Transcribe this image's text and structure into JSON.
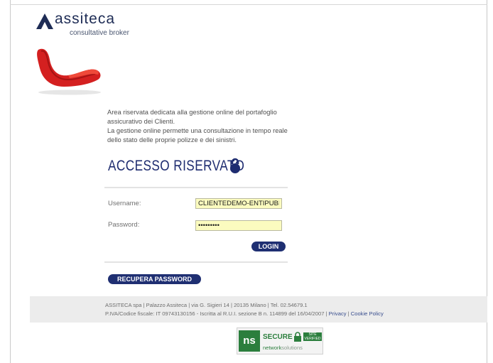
{
  "brand": {
    "name": "assiteca",
    "tagline": "consultative broker"
  },
  "intro": [
    "Area riservata dedicata alla gestione online del portafoglio",
    "assicurativo dei Clienti.",
    "La gestione online permette una consultazione in tempo reale",
    "dello stato delle proprie polizze e dei sinistri."
  ],
  "login": {
    "title": "ACCESSO RISERVATO",
    "username_label": "Username:",
    "username_value": "CLIENTEDEMO-ENTIPUBBI",
    "password_label": "Password:",
    "password_value": "•••••••••",
    "login_button": "LOGIN",
    "recover_button": "RECUPERA PASSWORD"
  },
  "footer": {
    "line1": "ASSITECA spa | Palazzo Assiteca | via G. Sigieri 14 | 20135 Milano | Tel. 02.54679.1",
    "line2": "P.IVA/Codice fiscale: IT 09743130156 - Iscritta al R.U.I. sezione B n. 114899 del 16/04/2007 | ",
    "privacy": "Privacy",
    "separator": " | ",
    "cookie": "Cookie Policy"
  },
  "badge": {
    "ns": "ns",
    "secure": "SECURE",
    "verified": "SITE VERIFIED",
    "brand_bold": "network",
    "brand_light": "solutions"
  },
  "colors": {
    "navy": "#1f2f72",
    "logo": "#1e2c55",
    "chair_red": "#d42020",
    "field_bg": "#fbfbbf",
    "badge_green": "#2b7e3d"
  }
}
